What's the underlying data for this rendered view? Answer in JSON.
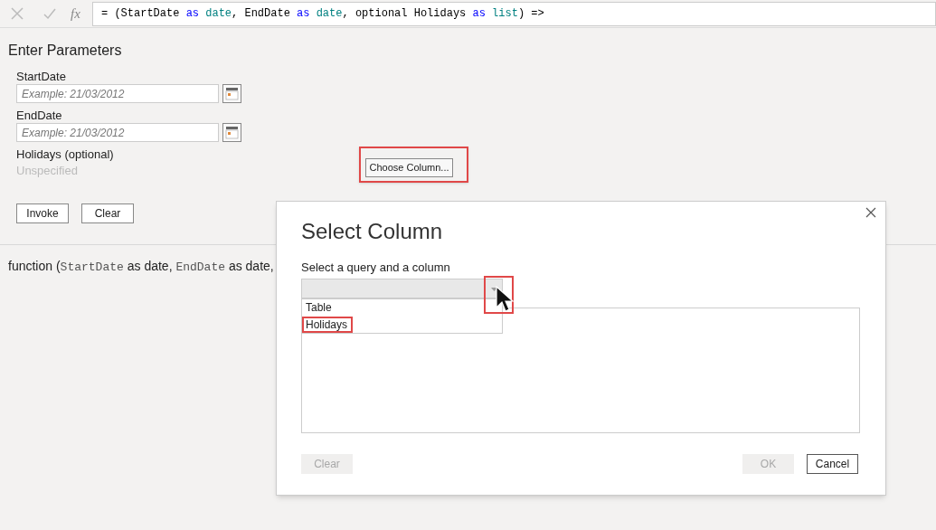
{
  "formula_bar": {
    "fx": "fx",
    "tokens": [
      {
        "text": "= (StartDate ",
        "kind": "plain"
      },
      {
        "text": "as",
        "kind": "keyword"
      },
      {
        "text": " date",
        "kind": "type"
      },
      {
        "text": ", EndDate ",
        "kind": "plain"
      },
      {
        "text": "as",
        "kind": "keyword"
      },
      {
        "text": " date",
        "kind": "type"
      },
      {
        "text": ", optional Holidays ",
        "kind": "plain"
      },
      {
        "text": "as",
        "kind": "keyword"
      },
      {
        "text": " list",
        "kind": "type"
      },
      {
        "text": ") =>",
        "kind": "plain"
      }
    ]
  },
  "panel": {
    "title": "Enter Parameters",
    "parameters": [
      {
        "label": "StartDate",
        "kind": "date",
        "placeholder": "Example: 21/03/2012"
      },
      {
        "label": "EndDate",
        "kind": "date",
        "placeholder": "Example: 21/03/2012"
      },
      {
        "label": "Holidays (optional)",
        "kind": "column",
        "value": "Unspecified",
        "button": "Choose Column...",
        "annotated": true
      }
    ],
    "buttons": [
      "Invoke",
      "Clear"
    ]
  },
  "signature": [
    {
      "text": "function (",
      "kind": "plain"
    },
    {
      "text": "StartDate",
      "kind": "code"
    },
    {
      "text": " as date, ",
      "kind": "plain"
    },
    {
      "text": "EndDate",
      "kind": "code"
    },
    {
      "text": " as date,",
      "kind": "plain"
    }
  ],
  "dialog": {
    "title": "Select Column",
    "label": "Select a query and a column",
    "arrow_annotated": true,
    "options": [
      {
        "label": "Table",
        "annotated": false
      },
      {
        "label": "Holidays",
        "annotated": true
      }
    ],
    "buttons": [
      {
        "label": "Clear",
        "disabled": true
      },
      {
        "label": "OK",
        "disabled": true
      },
      {
        "label": "Cancel",
        "disabled": false
      }
    ]
  }
}
